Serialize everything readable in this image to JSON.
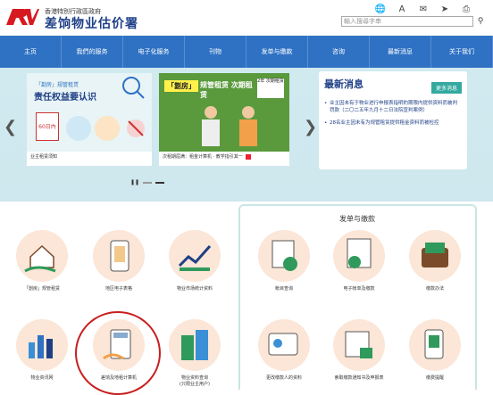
{
  "header": {
    "gov_line": "香港特別行政區政府",
    "dept_name": "差饷物业估价署",
    "search_placeholder": "輸入搜尋字串",
    "icons": [
      "globe-icon",
      "text-size-icon",
      "chat-icon",
      "share-icon",
      "print-icon"
    ]
  },
  "nav": [
    "主页",
    "我們的服务",
    "电子化服务",
    "刊物",
    "发单与缴款",
    "咨询",
    "最新消息",
    "关于我们"
  ],
  "banner": {
    "card1": {
      "tag": "「劏房」规管租赁",
      "headline": "责任权益要认识",
      "badge": "60日內",
      "caption": "业主租赁须知"
    },
    "card2": {
      "tag": "「劏房」",
      "headline": "规管租赁 次期租赁",
      "badge": "2年 次期租赁",
      "caption": "次租期屆满：租金计算机 · 教学指引其一"
    },
    "news": {
      "title": "最新消息",
      "more": "更多消息",
      "items": [
        "业主因未有于物业进行申报表指明的期限内提供资料而被判罚款（二〇二五年九月十二日法院宣判案例）",
        "28名业主因未有为规管租赁提供租金资料而被检控"
      ]
    }
  },
  "services_left": [
    {
      "label": "「劏房」规管租赁",
      "icon": "house-hand-icon"
    },
    {
      "label": "地区电子表格",
      "icon": "phone-form-icon"
    },
    {
      "label": "物业市场统计资料",
      "icon": "chart-up-icon"
    },
    {
      "label": "物业资讯网",
      "icon": "bar-chart-icon"
    },
    {
      "label": "差饷及地租计算机",
      "icon": "calculator-icon"
    },
    {
      "label": "物业资料查询\n(只限业主用户)",
      "icon": "buildings-icon"
    }
  ],
  "panel": {
    "title": "发单与缴款",
    "items": [
      {
        "label": "帐目查询",
        "icon": "calculator-sheet-icon"
      },
      {
        "label": "电子帐单及缴款",
        "icon": "bill-icon"
      },
      {
        "label": "缴款办法",
        "icon": "wallet-icon"
      },
      {
        "label": "更改缴款人的资料",
        "icon": "id-card-icon"
      },
      {
        "label": "索取缴款通知书及申报表",
        "icon": "doc-envelope-icon"
      },
      {
        "label": "缴费提醒",
        "icon": "mobile-pay-icon"
      }
    ]
  },
  "colors": {
    "nav": "#2f72c4",
    "brand": "#1e3f86",
    "accent": "#34a9a0",
    "tile": "#fbe6d7",
    "logo": "#d71920"
  }
}
